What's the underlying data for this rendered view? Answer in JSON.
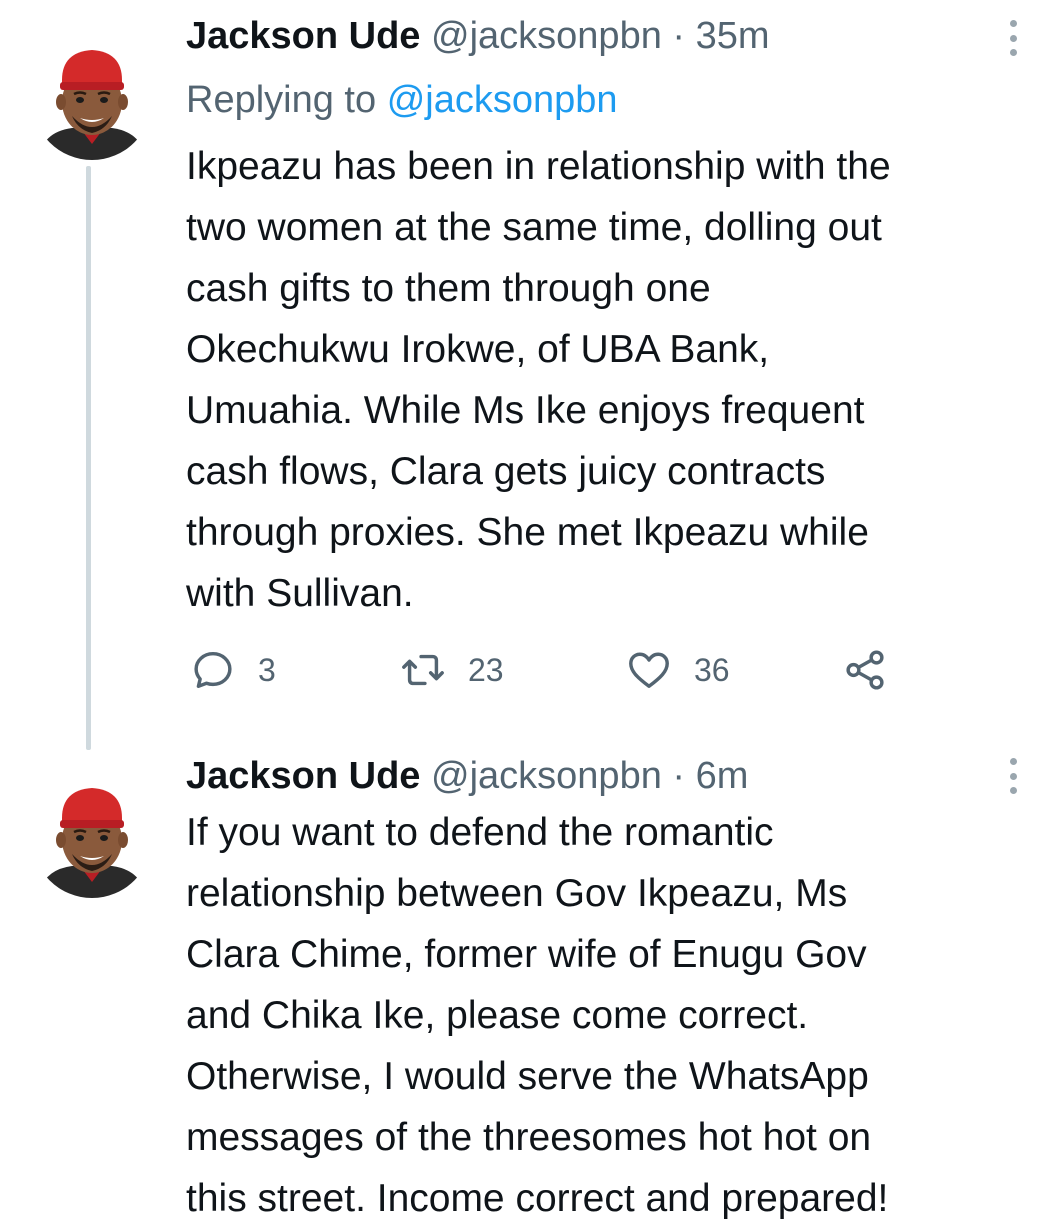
{
  "tweets": [
    {
      "name": "Jackson Ude",
      "handle": "@jacksonpbn",
      "separator": "·",
      "time": "35m",
      "replying_prefix": "Replying to",
      "replying_handle": "@jacksonpbn",
      "lines": [
        "Ikpeazu has been in relationship with the",
        "two women at the same time, dolling out",
        "cash gifts to them through one",
        "Okechukwu Irokwe, of UBA Bank,",
        "Umuahia. While Ms Ike enjoys frequent",
        "cash flows, Clara gets juicy contracts",
        "through proxies. She met Ikpeazu while",
        "with Sullivan."
      ],
      "replies": "3",
      "retweets": "23",
      "likes": "36"
    },
    {
      "name": "Jackson Ude",
      "handle": "@jacksonpbn",
      "separator": "·",
      "time": "6m",
      "lines": [
        "If you want to defend the romantic",
        "relationship between Gov Ikpeazu, Ms",
        "Clara Chime, former wife of Enugu Gov",
        "and Chika Ike, please come correct.",
        "Otherwise, I would serve the WhatsApp",
        "messages of the threesomes hot hot on",
        "this street. Income correct and prepared!"
      ]
    }
  ],
  "icons": {
    "avatar": "cartoon-avatar-red-cap",
    "more": "more-vertical-icon",
    "reply": "reply-icon",
    "retweet": "retweet-icon",
    "like": "heart-icon",
    "share": "share-icon"
  },
  "colors": {
    "text": "#0f1419",
    "muted": "#536471",
    "link": "#1d9bf0",
    "thread_line": "#cfd9de"
  }
}
